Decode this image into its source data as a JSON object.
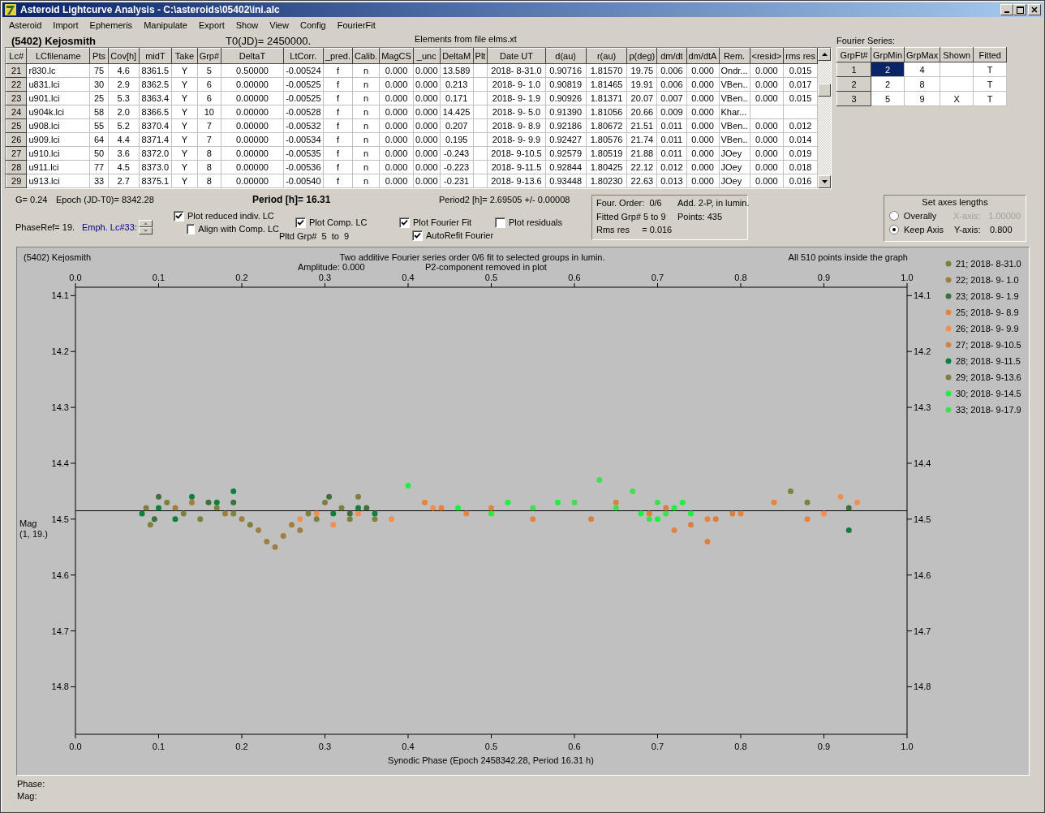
{
  "window": {
    "title": "Asteroid Lightcurve Analysis - C:\\asteroids\\05402\\ini.alc"
  },
  "menu": [
    "Asteroid",
    "Import",
    "Ephemeris",
    "Manipulate",
    "Export",
    "Show",
    "View",
    "Config",
    "FourierFit"
  ],
  "header": {
    "object_name": "(5402) Kejosmith",
    "t0": "T0(JD)= 2450000.",
    "elements": "Elements from file elms.xt"
  },
  "table": {
    "columns": [
      "Lc#",
      "LCfilename",
      "Pts",
      "Cov[h]",
      "midT",
      "Take",
      "Grp#",
      "DeltaT",
      "LtCorr.",
      "_pred.",
      "Calib.",
      "MagCS",
      "_unc",
      "DeltaM",
      "Plt",
      "Date UT",
      "d(au)",
      "r(au)",
      "p(deg)",
      "dm/dt",
      "dm/dtA",
      "Rem.",
      "<resid>",
      "rms res"
    ],
    "rows": [
      [
        "21",
        "r830.lc",
        "75",
        "4.6",
        "8361.5",
        "Y",
        "5",
        "0.50000",
        "-0.00524",
        "f",
        "n",
        "0.000",
        "0.000",
        "13.589",
        null,
        "2018- 8-31.0",
        "0.90716",
        "1.81570",
        "19.75",
        "0.006",
        "0.000",
        "Ondr...",
        "0.000",
        "0.015"
      ],
      [
        "22",
        "u831.lci",
        "30",
        "2.9",
        "8362.5",
        "Y",
        "6",
        "0.00000",
        "-0.00525",
        "f",
        "n",
        "0.000",
        "0.000",
        "0.213",
        null,
        "2018- 9- 1.0",
        "0.90819",
        "1.81465",
        "19.91",
        "0.006",
        "0.000",
        "VBen..",
        "0.000",
        "0.017"
      ],
      [
        "23",
        "u901.lci",
        "25",
        "5.3",
        "8363.4",
        "Y",
        "6",
        "0.00000",
        "-0.00525",
        "f",
        "n",
        "0.000",
        "0.000",
        "0.171",
        null,
        "2018- 9- 1.9",
        "0.90926",
        "1.81371",
        "20.07",
        "0.007",
        "0.000",
        "VBen..",
        "0.000",
        "0.015"
      ],
      [
        "24",
        "u904k.lci",
        "58",
        "2.0",
        "8366.5",
        "Y",
        "10",
        "0.00000",
        "-0.00528",
        "f",
        "n",
        "0.000",
        "0.000",
        "14.425",
        null,
        "2018- 9- 5.0",
        "0.91390",
        "1.81056",
        "20.66",
        "0.009",
        "0.000",
        "Khar...",
        null,
        null
      ],
      [
        "25",
        "u908.lci",
        "55",
        "5.2",
        "8370.4",
        "Y",
        "7",
        "0.00000",
        "-0.00532",
        "f",
        "n",
        "0.000",
        "0.000",
        "0.207",
        null,
        "2018- 9- 8.9",
        "0.92186",
        "1.80672",
        "21.51",
        "0.011",
        "0.000",
        "VBen..",
        "0.000",
        "0.012"
      ],
      [
        "26",
        "u909.lci",
        "64",
        "4.4",
        "8371.4",
        "Y",
        "7",
        "0.00000",
        "-0.00534",
        "f",
        "n",
        "0.000",
        "0.000",
        "0.195",
        null,
        "2018- 9- 9.9",
        "0.92427",
        "1.80576",
        "21.74",
        "0.011",
        "0.000",
        "VBen..",
        "0.000",
        "0.014"
      ],
      [
        "27",
        "u910.lci",
        "50",
        "3.6",
        "8372.0",
        "Y",
        "8",
        "0.00000",
        "-0.00535",
        "f",
        "n",
        "0.000",
        "0.000",
        "-0.243",
        null,
        "2018- 9-10.5",
        "0.92579",
        "1.80519",
        "21.88",
        "0.011",
        "0.000",
        "JOey",
        "0.000",
        "0.019"
      ],
      [
        "28",
        "u911.lci",
        "77",
        "4.5",
        "8373.0",
        "Y",
        "8",
        "0.00000",
        "-0.00536",
        "f",
        "n",
        "0.000",
        "0.000",
        "-0.223",
        null,
        "2018- 9-11.5",
        "0.92844",
        "1.80425",
        "22.12",
        "0.012",
        "0.000",
        "JOey",
        "0.000",
        "0.018"
      ],
      [
        "29",
        "u913.lci",
        "33",
        "2.7",
        "8375.1",
        "Y",
        "8",
        "0.00000",
        "-0.00540",
        "f",
        "n",
        "0.000",
        "0.000",
        "-0.231",
        null,
        "2018- 9-13.6",
        "0.93448",
        "1.80230",
        "22.63",
        "0.013",
        "0.000",
        "JOey",
        "0.000",
        "0.016"
      ]
    ]
  },
  "fourier": {
    "title": "Fourier Series:",
    "columns": [
      "GrpFt#",
      "GrpMin",
      "GrpMax",
      "Shown",
      "Fitted"
    ],
    "rows": [
      [
        {
          "text": "1",
          "selected": false
        },
        {
          "text": "2",
          "selected": true
        },
        {
          "text": "4",
          "selected": false
        },
        {
          "selected": false
        },
        {
          "text": "T",
          "selected": false
        }
      ],
      [
        {
          "text": "2",
          "selected": false
        },
        {
          "text": "2",
          "selected": false
        },
        {
          "text": "8",
          "selected": false
        },
        {
          "selected": false
        },
        {
          "text": "T",
          "selected": false
        }
      ],
      [
        {
          "text": "3",
          "selected": false
        },
        {
          "text": "5",
          "selected": false
        },
        {
          "text": "9",
          "selected": false
        },
        {
          "text": "X",
          "selected": false
        },
        {
          "text": "T",
          "selected": false
        }
      ]
    ]
  },
  "parameters": {
    "g": "G= 0.24",
    "epoch": "Epoch (JD-T0)= 8342.28",
    "period": "Period [h]= 16.31",
    "period2": "Period2 [h]= 2.69505 +/- 0.00008",
    "phase_ref": "PhaseRef= 19.",
    "emph": "Emph. Lc#33:",
    "pltd_grp": "Pltd Grp#  5  to  9"
  },
  "checkboxes": [
    {
      "label": "Plot reduced indiv. LC",
      "checked": true
    },
    {
      "label": "Plot Comp. LC",
      "checked": true
    },
    {
      "label": "Plot Fourier Fit",
      "checked": true
    },
    {
      "label": "Plot residuals",
      "checked": false
    },
    {
      "label": "Align with Comp. LC",
      "checked": false
    },
    {
      "label": "AutoRefit Fourier",
      "checked": true
    }
  ],
  "fit_info": [
    "Four. Order:  0/6",
    "Add. 2-P, in lumin.",
    "Fitted Grp# 5 to 9",
    "Points: 435",
    "Rms res     = 0.016"
  ],
  "axes_lengths": {
    "title": "Set axes lengths",
    "options": [
      {
        "label": "Overally",
        "selected": false
      },
      {
        "label": "Keep Axis",
        "selected": true
      }
    ],
    "fields": [
      {
        "label": "X-axis:",
        "value": "1.00000",
        "disabled": true
      },
      {
        "label": "Y-axis:",
        "value": "0.800",
        "disabled": false
      }
    ]
  },
  "plot": {
    "object_name": "(5402) Kejosmith",
    "amplitude": "Amplitude: 0.000",
    "note": "P2-component removed in plot",
    "points_note": "All 510 points inside the graph",
    "ylabel_detail": "(1, 19.)",
    "top_tick_labels": [
      "0.0",
      "0.1",
      "0.2",
      "0.3",
      "0.4",
      "0.5",
      "0.6",
      "0.7",
      "0.8",
      "0.9",
      "1.0"
    ],
    "right_tick_labels": [
      "14.1",
      "14.2",
      "14.3",
      "14.4",
      "14.5",
      "14.6",
      "14.7",
      "14.8"
    ],
    "chart_data": {
      "type": "scatter",
      "title": "Two additive Fourier series order 0/6 fit to selected groups in lumin.",
      "xlabel": "Synodic Phase (Epoch 2458342.28, Period 16.31 h)",
      "ylabel": "Mag",
      "xlim": [
        0,
        1
      ],
      "ylim": [
        14.885,
        14.085
      ],
      "xticks": [
        {
          "value": 0,
          "label": "0.0"
        },
        {
          "value": 0.1,
          "label": "0.1"
        },
        {
          "value": 0.2,
          "label": "0.2"
        },
        {
          "value": 0.3,
          "label": "0.3"
        },
        {
          "value": 0.4,
          "label": "0.4"
        },
        {
          "value": 0.5,
          "label": "0.5"
        },
        {
          "value": 0.6,
          "label": "0.6"
        },
        {
          "value": 0.7,
          "label": "0.7"
        },
        {
          "value": 0.8,
          "label": "0.8"
        },
        {
          "value": 0.9,
          "label": "0.9"
        },
        {
          "value": 1,
          "label": "1.0"
        }
      ],
      "yticks": [
        {
          "value": 14.1,
          "label": "14.1"
        },
        {
          "value": 14.2,
          "label": "14.2"
        },
        {
          "value": 14.3,
          "label": "14.3"
        },
        {
          "value": 14.4,
          "label": "14.4"
        },
        {
          "value": 14.5,
          "label": "14.5"
        },
        {
          "value": 14.6,
          "label": "14.6"
        },
        {
          "value": 14.7,
          "label": "14.7"
        },
        {
          "value": 14.8,
          "label": "14.8"
        }
      ],
      "series": [
        {
          "name": "21; 2018- 8-31.0",
          "color": "#7f7f3f",
          "x": [
            0.085,
            0.09,
            0.11,
            0.13,
            0.15,
            0.17,
            0.19,
            0.21,
            0.86,
            0.88
          ],
          "values": [
            14.48,
            14.51,
            14.47,
            14.49,
            14.5,
            14.48,
            14.49,
            14.51,
            14.45,
            14.47
          ]
        },
        {
          "name": "22; 2018- 9- 1.0",
          "color": "#9f7f3f",
          "x": [
            0.12,
            0.14,
            0.18,
            0.2,
            0.22,
            0.23,
            0.24,
            0.25,
            0.27,
            0.26
          ],
          "values": [
            14.48,
            14.47,
            14.49,
            14.5,
            14.52,
            14.54,
            14.55,
            14.53,
            14.52,
            14.51
          ]
        },
        {
          "name": "23; 2018- 9- 1.9",
          "color": "#3f6f3f",
          "x": [
            0.095,
            0.1,
            0.16,
            0.19,
            0.305,
            0.33,
            0.35,
            0.93
          ],
          "values": [
            14.5,
            14.46,
            14.47,
            14.47,
            14.46,
            14.49,
            14.48,
            14.48
          ]
        },
        {
          "name": "25; 2018- 9- 8.9",
          "color": "#e8823f",
          "x": [
            0.42,
            0.44,
            0.47,
            0.5,
            0.55,
            0.72,
            0.76,
            0.8,
            0.84,
            0.88
          ],
          "values": [
            14.47,
            14.48,
            14.49,
            14.48,
            14.5,
            14.52,
            14.5,
            14.49,
            14.47,
            14.5
          ]
        },
        {
          "name": "26; 2018- 9- 9.9",
          "color": "#f08f4f",
          "x": [
            0.27,
            0.29,
            0.31,
            0.34,
            0.38,
            0.43,
            0.9,
            0.92,
            0.94
          ],
          "values": [
            14.5,
            14.49,
            14.51,
            14.49,
            14.5,
            14.48,
            14.49,
            14.46,
            14.47
          ]
        },
        {
          "name": "27; 2018- 9-10.5",
          "color": "#d8803f",
          "x": [
            0.62,
            0.65,
            0.69,
            0.71,
            0.74,
            0.77,
            0.79,
            0.76
          ],
          "values": [
            14.5,
            14.47,
            14.49,
            14.48,
            14.51,
            14.5,
            14.49,
            14.54
          ]
        },
        {
          "name": "28; 2018- 9-11.5",
          "color": "#0f7f3f",
          "x": [
            0.08,
            0.1,
            0.12,
            0.14,
            0.17,
            0.19,
            0.31,
            0.34,
            0.36,
            0.93
          ],
          "values": [
            14.49,
            14.48,
            14.5,
            14.46,
            14.47,
            14.45,
            14.49,
            14.48,
            14.49,
            14.52
          ]
        },
        {
          "name": "29; 2018- 9-13.6",
          "color": "#7f7f3f",
          "x": [
            0.28,
            0.29,
            0.3,
            0.32,
            0.33,
            0.34,
            0.36
          ],
          "values": [
            14.49,
            14.5,
            14.47,
            14.48,
            14.5,
            14.46,
            14.5
          ]
        },
        {
          "name": "30; 2018- 9-14.5",
          "color": "#1fef3f",
          "x": [
            0.4,
            0.46,
            0.5,
            0.52,
            0.58,
            0.68,
            0.7,
            0.72,
            0.74,
            0.73
          ],
          "values": [
            14.44,
            14.48,
            14.49,
            14.47,
            14.47,
            14.49,
            14.5,
            14.48,
            14.49,
            14.47
          ]
        },
        {
          "name": "33; 2018- 9-17.9",
          "color": "#3fdf4f",
          "x": [
            0.55,
            0.6,
            0.63,
            0.65,
            0.67,
            0.69,
            0.71,
            0.7
          ],
          "values": [
            14.48,
            14.47,
            14.43,
            14.48,
            14.45,
            14.5,
            14.49,
            14.47
          ]
        }
      ],
      "ref_lines": [
        {
          "axis": "y",
          "value": 14.485
        }
      ],
      "legend": true
    }
  },
  "status": [
    "Phase:",
    "Mag:"
  ]
}
